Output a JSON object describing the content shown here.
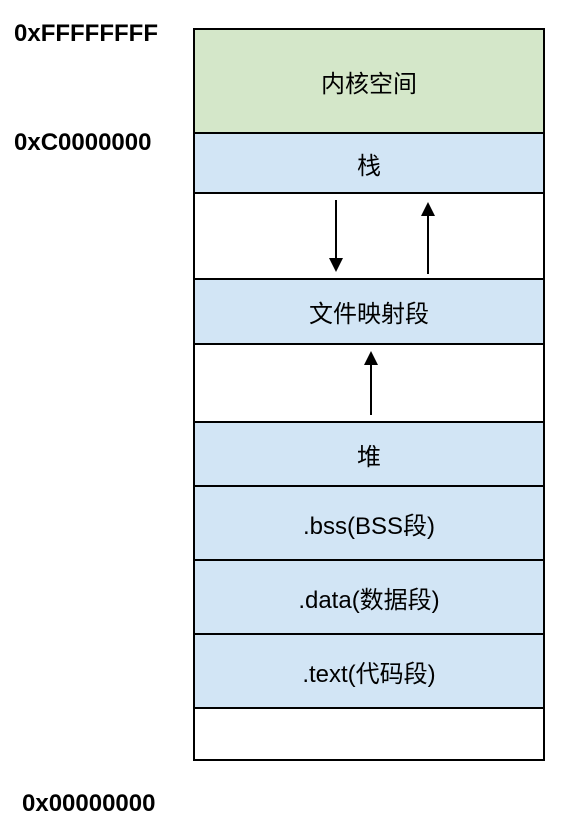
{
  "addresses": {
    "top": "0xFFFFFFFF",
    "kernel_boundary": "0xC0000000",
    "bottom": "0x00000000"
  },
  "regions": {
    "kernel": "内核空间",
    "stack": "栈",
    "mmap": "文件映射段",
    "heap": "堆",
    "bss": ".bss(BSS段)",
    "data": ".data(数据段)",
    "text": ".text(代码段)"
  },
  "colors": {
    "kernel_bg": "#d4e7c9",
    "user_bg": "#d2e5f5",
    "gap_bg": "#ffffff",
    "border": "#000000"
  }
}
